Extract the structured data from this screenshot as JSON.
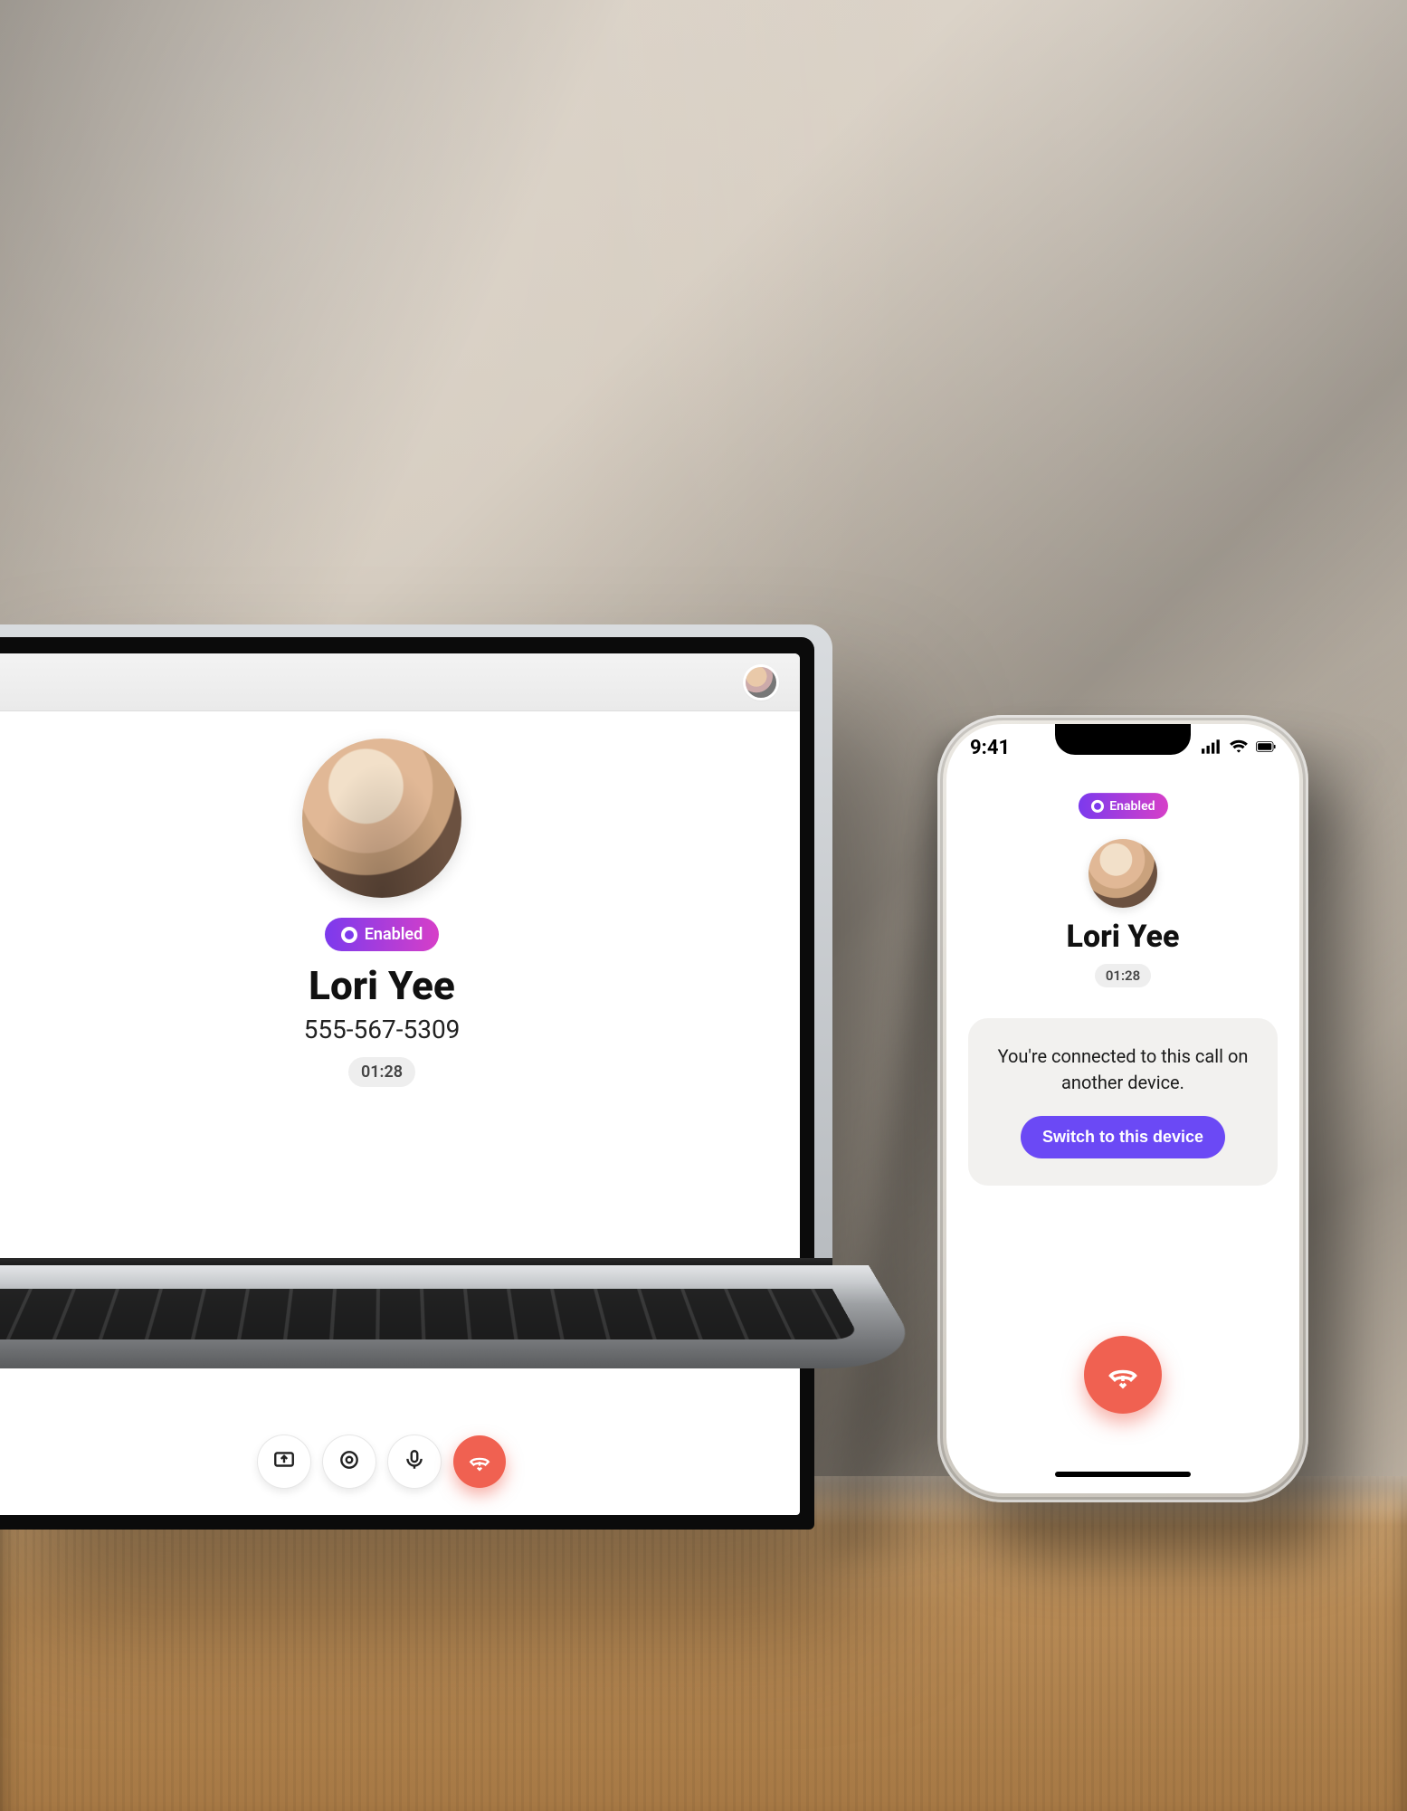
{
  "colors": {
    "accent_purple": "#7C3AED",
    "accent_magenta": "#D63FC8",
    "primary_action": "#6B49F5",
    "hangup_red": "#F06151"
  },
  "contact": {
    "name": "Lori Yee",
    "phone": "555-567-5309"
  },
  "laptop": {
    "enabled_badge": "Enabled",
    "call_duration": "01:28",
    "controls": {
      "share_screen_tooltip": "Share screen",
      "record_tooltip": "Record",
      "mute_tooltip": "Mute",
      "hangup_tooltip": "End call"
    }
  },
  "phone": {
    "status_time": "9:41",
    "enabled_badge": "Enabled",
    "call_duration": "01:28",
    "info_message": "You're connected to this call on another device.",
    "switch_button": "Switch to this device",
    "hangup_tooltip": "End call"
  }
}
